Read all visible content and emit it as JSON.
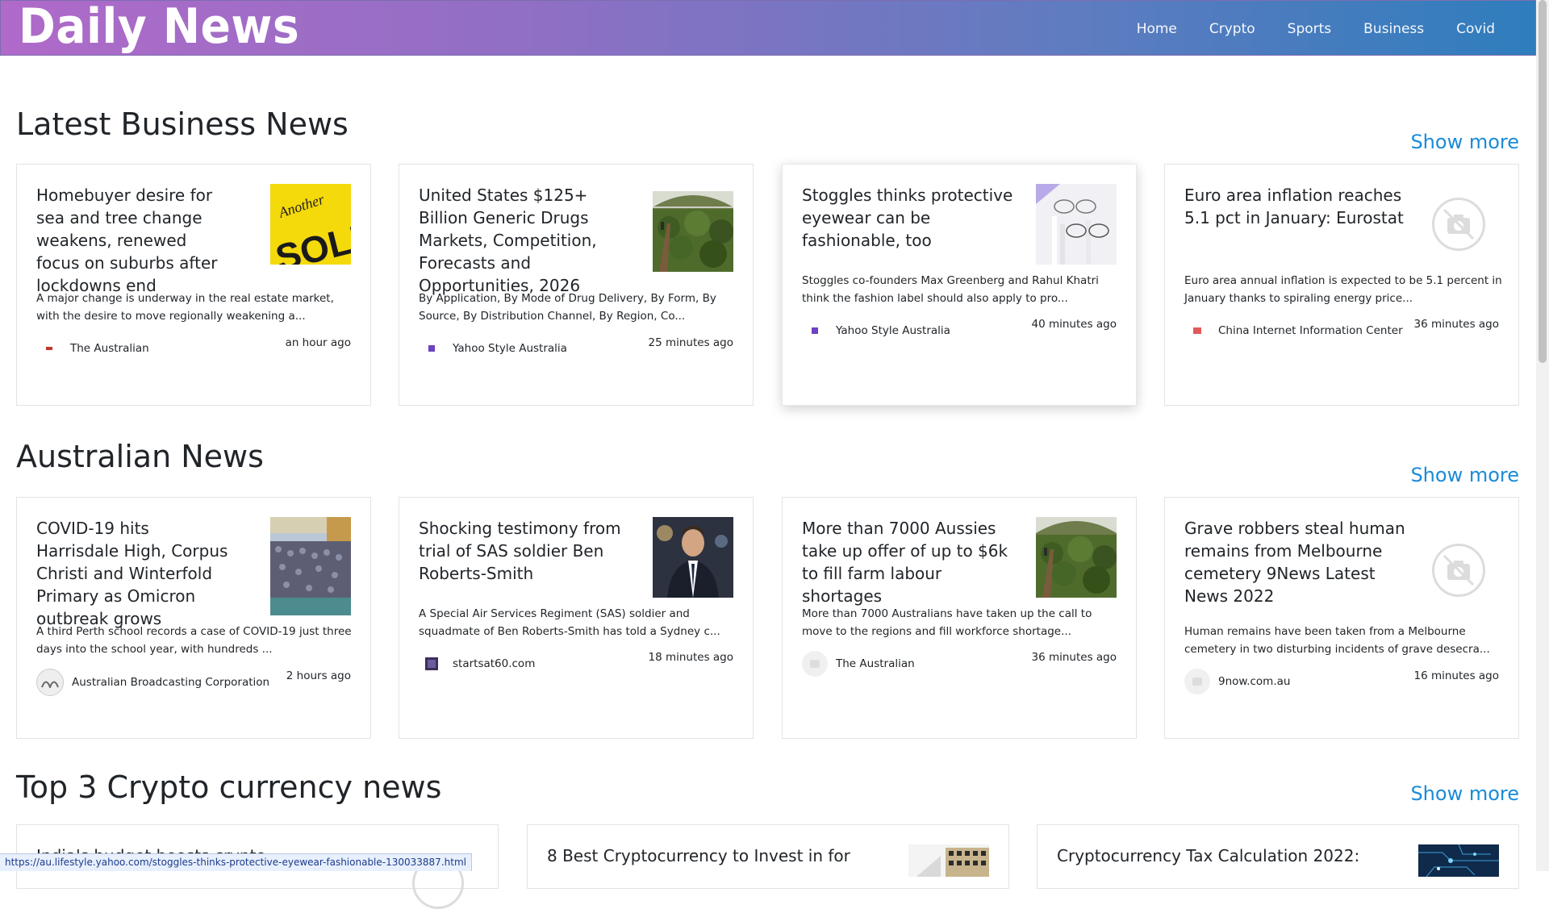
{
  "brand": "Daily News",
  "nav": [
    "Home",
    "Crypto",
    "Sports",
    "Business",
    "Covid"
  ],
  "sections": [
    {
      "title": "Latest Business News",
      "show_more": "Show more",
      "cards": [
        {
          "title": "Homebuyer desire for sea and tree change weakens, renewed focus on suburbs after lockdowns end",
          "desc": "A major change is underway in the real estate market, with the desire to move regionally weakening a...",
          "source": "The Australian",
          "time": "an hour ago",
          "image": "sold-sign"
        },
        {
          "title": "United States $125+ Billion Generic Drugs Markets, Competition, Forecasts and Opportunities, 2026",
          "desc": "By Application, By Mode of Drug Delivery, By Form, By Source, By Distribution Channel, By Region, Co...",
          "source": "Yahoo Style Australia",
          "time": "25 minutes ago",
          "image": "greenhouse"
        },
        {
          "title": "Stoggles thinks protective eyewear can be fashionable, too",
          "desc": "Stoggles co-founders Max Greenberg and Rahul Khatri think the fashion label should also apply to pro...",
          "source": "Yahoo Style Australia",
          "time": "40 minutes ago",
          "image": "eyewear"
        },
        {
          "title": "Euro area inflation reaches 5.1 pct in January: Eurostat",
          "desc": "Euro area annual inflation is expected to be 5.1 percent in January thanks to spiraling energy price...",
          "source": "China Internet Information Center",
          "time": "36 minutes ago",
          "image": "none"
        }
      ]
    },
    {
      "title": "Australian News",
      "show_more": "Show more",
      "cards": [
        {
          "title": "COVID-19 hits Harrisdale High, Corpus Christi and Winterfold Primary as Omicron outbreak grows",
          "desc": "A third Perth school records a case of COVID-19 just three days into the school year, with hundreds ...",
          "source": "Australian Broadcasting Corporation",
          "time": "2 hours ago",
          "image": "crowd"
        },
        {
          "title": "Shocking testimony from trial of SAS soldier Ben Roberts-Smith",
          "desc": "A Special Air Services Regiment (SAS) soldier and squadmate of Ben Roberts-Smith has told a Sydney c...",
          "source": "startsat60.com",
          "time": "18 minutes ago",
          "image": "suit"
        },
        {
          "title": "More than 7000 Aussies take up offer of up to $6k to fill farm labour shortages",
          "desc": "More than 7000 Australians have taken up the call to move to the regions and fill workforce shortage...",
          "source": "The Australian",
          "time": "36 minutes ago",
          "image": "greenhouse"
        },
        {
          "title": "Grave robbers steal human remains from Melbourne cemetery 9News Latest News 2022",
          "desc": "Human remains have been taken from a Melbourne cemetery in two disturbing incidents of grave desecra...",
          "source": "9now.com.au",
          "time": "16 minutes ago",
          "image": "none"
        }
      ]
    },
    {
      "title": "Top 3 Crypto currency news",
      "show_more": "Show more",
      "cards": [
        {
          "title": "India's budget boosts crypto...",
          "image": "none"
        },
        {
          "title": "8 Best Cryptocurrency to Invest in for",
          "image": "building"
        },
        {
          "title": "Cryptocurrency Tax Calculation 2022:",
          "image": "circuit"
        }
      ]
    }
  ],
  "status_url": "https://au.lifestyle.yahoo.com/stoggles-thinks-protective-eyewear-fashionable-130033887.html",
  "colors": {
    "accent": "#1a8bd8",
    "header_start": "#b06ac9",
    "header_end": "#2f7dbd"
  }
}
